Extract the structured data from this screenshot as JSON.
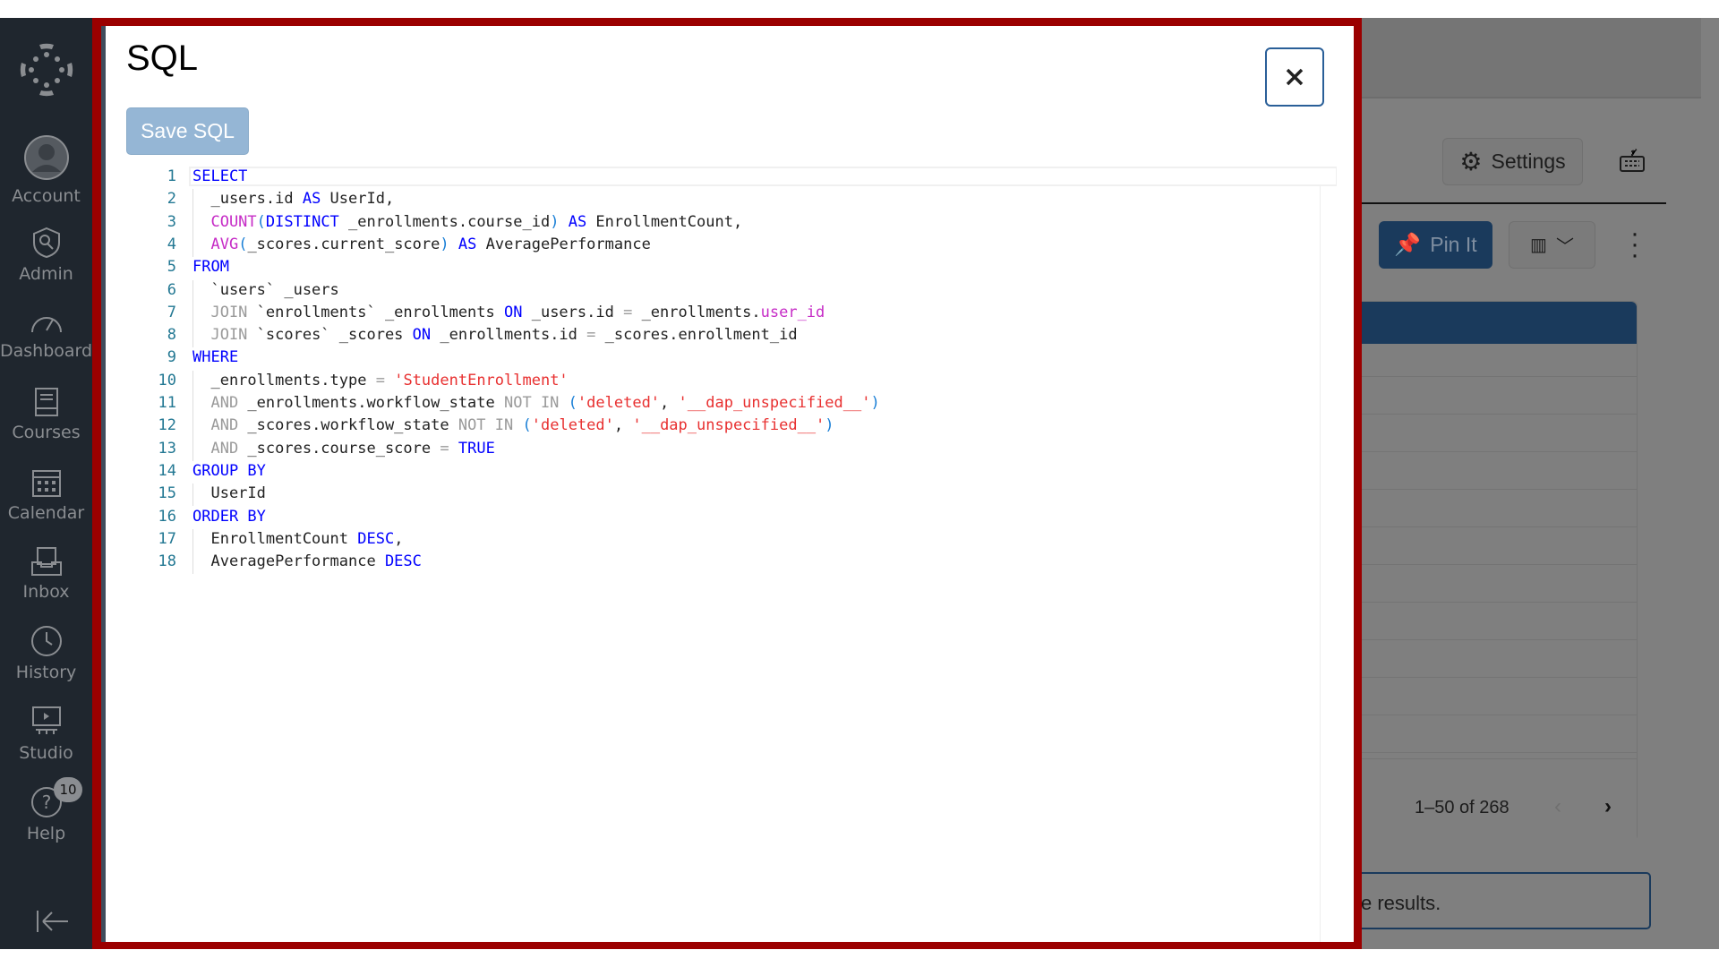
{
  "sidebar": {
    "items": [
      {
        "label": "Account",
        "icon": "account-icon"
      },
      {
        "label": "Admin",
        "icon": "admin-shield-icon"
      },
      {
        "label": "Dashboard",
        "icon": "dashboard-icon"
      },
      {
        "label": "Courses",
        "icon": "courses-icon"
      },
      {
        "label": "Calendar",
        "icon": "calendar-icon"
      },
      {
        "label": "Inbox",
        "icon": "inbox-icon"
      },
      {
        "label": "History",
        "icon": "history-icon"
      },
      {
        "label": "Studio",
        "icon": "studio-icon"
      },
      {
        "label": "Help",
        "icon": "help-icon",
        "badge": "10"
      }
    ]
  },
  "modal": {
    "title": "SQL",
    "save_label": "Save SQL",
    "close_icon": "close-icon",
    "frame_color": "#9b0000"
  },
  "code": [
    [
      [
        "kw",
        "SELECT"
      ]
    ],
    [
      [
        "",
        "  _users.id "
      ],
      [
        "kw",
        "AS"
      ],
      [
        "",
        " UserId,"
      ]
    ],
    [
      [
        "fn",
        "  COUNT"
      ],
      [
        "par",
        "("
      ],
      [
        "kw",
        "DISTINCT"
      ],
      [
        "",
        " _enrollments.course_id"
      ],
      [
        "par",
        ")"
      ],
      [
        "",
        " "
      ],
      [
        "kw",
        "AS"
      ],
      [
        "",
        " EnrollmentCount,"
      ]
    ],
    [
      [
        "fn",
        "  AVG"
      ],
      [
        "par",
        "("
      ],
      [
        "",
        "_scores.current_score"
      ],
      [
        "par",
        ")"
      ],
      [
        "",
        " "
      ],
      [
        "kw",
        "AS"
      ],
      [
        "",
        " AveragePerformance"
      ]
    ],
    [
      [
        "kw",
        "FROM"
      ]
    ],
    [
      [
        "",
        "  `users` _users"
      ]
    ],
    [
      [
        "op",
        "  JOIN"
      ],
      [
        "",
        " `enrollments` _enrollments "
      ],
      [
        "kw",
        "ON"
      ],
      [
        "",
        " _users.id "
      ],
      [
        "op",
        "="
      ],
      [
        "",
        " _enrollments."
      ],
      [
        "prop",
        "user_id"
      ]
    ],
    [
      [
        "op",
        "  JOIN"
      ],
      [
        "",
        " `scores` _scores "
      ],
      [
        "kw",
        "ON"
      ],
      [
        "",
        " _enrollments.id "
      ],
      [
        "op",
        "="
      ],
      [
        "",
        " _scores.enrollment_id"
      ]
    ],
    [
      [
        "kw",
        "WHERE"
      ]
    ],
    [
      [
        "",
        "  _enrollments.type "
      ],
      [
        "op",
        "="
      ],
      [
        "",
        " "
      ],
      [
        "str",
        "'StudentEnrollment'"
      ]
    ],
    [
      [
        "op",
        "  AND"
      ],
      [
        "",
        " _enrollments.workflow_state "
      ],
      [
        "op",
        "NOT IN"
      ],
      [
        "",
        " "
      ],
      [
        "par",
        "("
      ],
      [
        "str",
        "'deleted'"
      ],
      [
        "",
        ", "
      ],
      [
        "str",
        "'__dap_unspecified__'"
      ],
      [
        "par",
        ")"
      ]
    ],
    [
      [
        "op",
        "  AND"
      ],
      [
        "",
        " _scores.workflow_state "
      ],
      [
        "op",
        "NOT IN"
      ],
      [
        "",
        " "
      ],
      [
        "par",
        "("
      ],
      [
        "str",
        "'deleted'"
      ],
      [
        "",
        ", "
      ],
      [
        "str",
        "'__dap_unspecified__'"
      ],
      [
        "par",
        ")"
      ]
    ],
    [
      [
        "op",
        "  AND"
      ],
      [
        "",
        " _scores.course_score "
      ],
      [
        "op",
        "="
      ],
      [
        "",
        " "
      ],
      [
        "kw",
        "TRUE"
      ]
    ],
    [
      [
        "kw",
        "GROUP BY"
      ]
    ],
    [
      [
        "",
        "  UserId"
      ]
    ],
    [
      [
        "kw",
        "ORDER BY"
      ]
    ],
    [
      [
        "",
        "  EnrollmentCount "
      ],
      [
        "kw",
        "DESC"
      ],
      [
        "",
        ","
      ]
    ],
    [
      [
        "",
        "  AveragePerformance "
      ],
      [
        "kw",
        "DESC"
      ]
    ]
  ],
  "background": {
    "settings_label": "Settings",
    "pin_label": "Pin It",
    "pagination": "1–50 of 268",
    "results_text": "e results."
  }
}
